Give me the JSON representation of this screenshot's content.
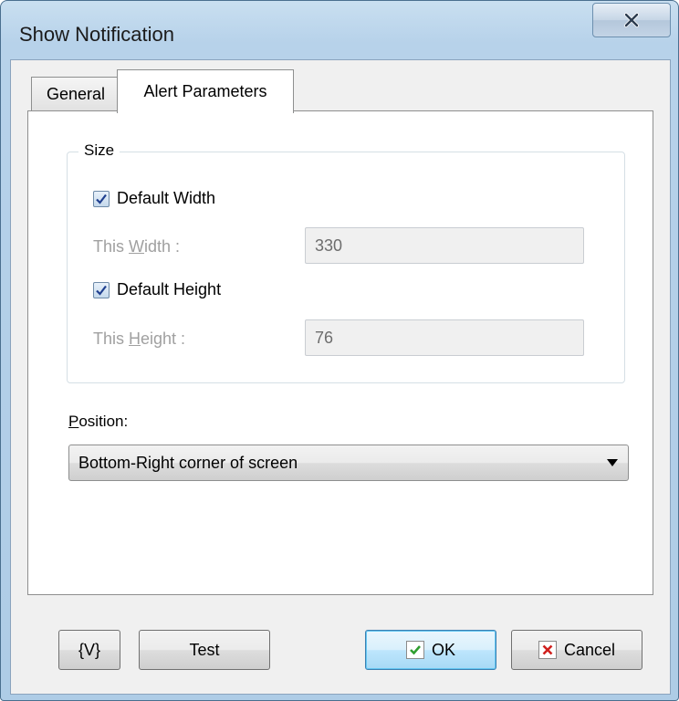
{
  "window": {
    "title": "Show Notification",
    "close_icon": "close-icon"
  },
  "tabs": [
    {
      "label": "General",
      "selected": false
    },
    {
      "label": "Alert Parameters",
      "selected": true
    }
  ],
  "size_group": {
    "legend": "Size",
    "default_width": {
      "label": "Default Width",
      "checked": true
    },
    "this_width": {
      "label_pre": "This ",
      "label_ul": "W",
      "label_post": "idth :",
      "value": "330",
      "enabled": false
    },
    "default_height": {
      "label": "Default Height",
      "checked": true
    },
    "this_height": {
      "label_pre": "This ",
      "label_ul": "H",
      "label_post": "eight :",
      "value": "76",
      "enabled": false
    }
  },
  "position": {
    "label_ul": "P",
    "label_post": "osition:",
    "selected": "Bottom-Right corner of screen"
  },
  "buttons": {
    "variables": "{V}",
    "test": "Test",
    "ok": "OK",
    "cancel": "Cancel"
  },
  "colors": {
    "ok_check": "#2f9e2f",
    "cancel_x": "#d0201d",
    "checkmark": "#1f3f8f"
  }
}
